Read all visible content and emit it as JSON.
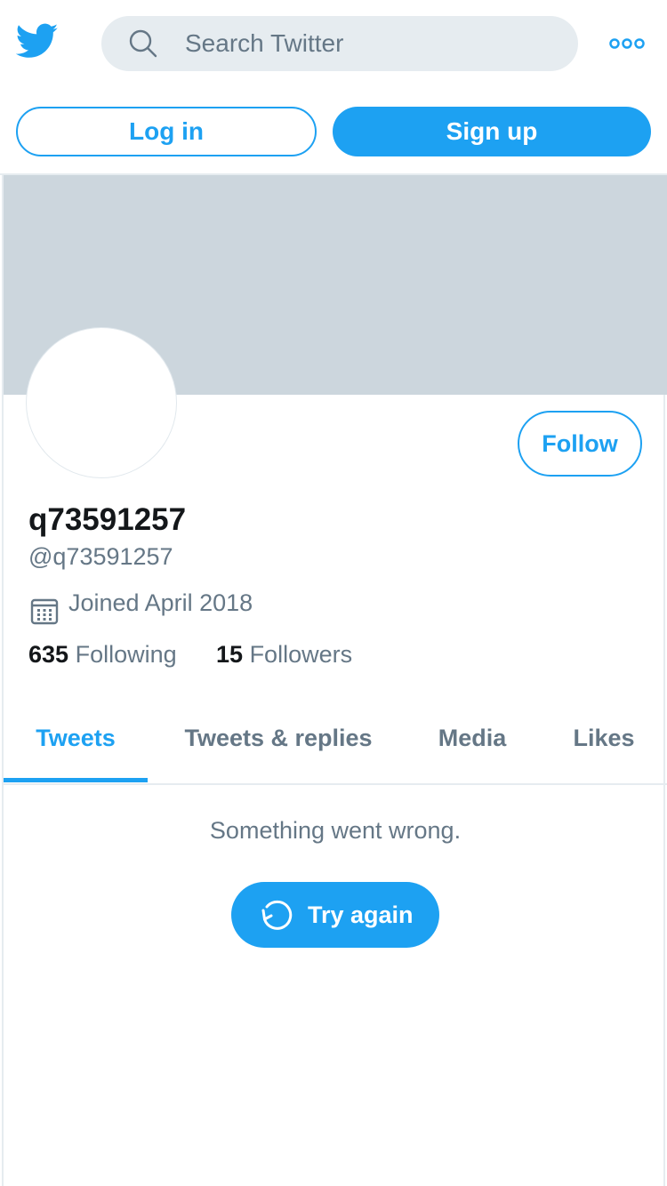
{
  "header": {
    "logo_icon": "twitter-bird-icon",
    "search_placeholder": "Search Twitter",
    "search_icon": "search-icon",
    "more_icon": "more-dots-icon"
  },
  "auth": {
    "login_label": "Log in",
    "signup_label": "Sign up"
  },
  "profile": {
    "display_name": "q73591257",
    "handle": "@q73591257",
    "joined": "Joined April 2018",
    "calendar_icon": "calendar-icon",
    "follow_label": "Follow",
    "following_count": "635",
    "following_label": "Following",
    "followers_count": "15",
    "followers_label": "Followers"
  },
  "tabs": [
    {
      "label": "Tweets",
      "active": true
    },
    {
      "label": "Tweets & replies",
      "active": false
    },
    {
      "label": "Media",
      "active": false
    },
    {
      "label": "Likes",
      "active": false
    }
  ],
  "timeline": {
    "error_message": "Something went wrong.",
    "retry_label": "Try again",
    "retry_icon": "refresh-icon"
  },
  "colors": {
    "accent": "#1da1f2",
    "banner": "#ccd6dd",
    "secondary_text": "#657786",
    "search_bg": "#e6ecf0"
  }
}
